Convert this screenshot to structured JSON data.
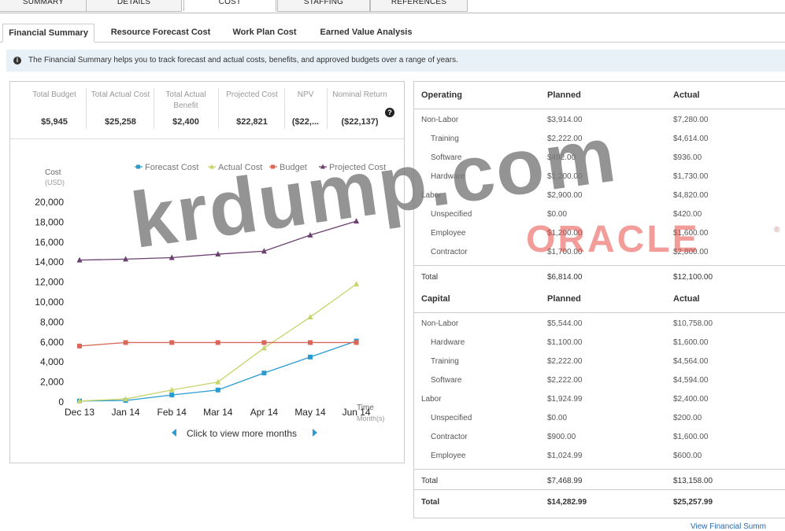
{
  "top_tabs": [
    "SUMMARY",
    "DETAILS",
    "COST",
    "STAFFING",
    "REFERENCES"
  ],
  "sub_tabs": [
    "Financial Summary",
    "Resource Forecast Cost",
    "Work Plan Cost",
    "Earned Value Analysis"
  ],
  "info": {
    "text": "The Financial Summary helps you to track forecast and actual costs, benefits, and approved budgets over a range of years.",
    "icon": "info-icon"
  },
  "kpis": [
    {
      "label": "Total Budget",
      "value": "$5,945"
    },
    {
      "label": "Total Actual Cost",
      "value": "$25,258"
    },
    {
      "label": "Total Actual Benefit",
      "value": "$2,400"
    },
    {
      "label": "Projected Cost",
      "value": "$22,821"
    },
    {
      "label": "NPV",
      "value": "($22,..."
    },
    {
      "label": "Nominal Return",
      "value": "($22,137)"
    }
  ],
  "help_icon": "help-icon",
  "chart_data": {
    "type": "line",
    "ylabel": "Cost",
    "ylabel_unit": "(USD)",
    "xlabel": "Time",
    "xlabel_unit": "Month(s)",
    "categories": [
      "Dec 13",
      "Jan 14",
      "Feb 14",
      "Mar 14",
      "Apr 14",
      "May 14",
      "Jun 14"
    ],
    "y_ticks": [
      "0",
      "2,000",
      "4,000",
      "6,000",
      "8,000",
      "10,000",
      "12,000",
      "14,000",
      "16,000",
      "18,000",
      "20,000"
    ],
    "ylim": [
      0,
      20000
    ],
    "legend_position": "top",
    "series": [
      {
        "name": "Forecast Cost",
        "color": "#2a9ad3",
        "marker": "square",
        "values": [
          100,
          150,
          700,
          1200,
          2900,
          4500,
          6100
        ]
      },
      {
        "name": "Actual Cost",
        "color": "#c8d46a",
        "marker": "triangle",
        "values": [
          100,
          300,
          1200,
          2000,
          5400,
          8500,
          11800
        ]
      },
      {
        "name": "Budget",
        "color": "#d9685a",
        "marker": "square",
        "values": [
          5600,
          5950,
          5950,
          5950,
          5950,
          5950,
          5950
        ]
      },
      {
        "name": "Projected Cost",
        "color": "#6b3f6e",
        "marker": "triangle",
        "values": [
          14200,
          14300,
          14450,
          14800,
          15100,
          16700,
          18100
        ]
      }
    ]
  },
  "nav": {
    "label": "Click to view more months",
    "prev_icon": "chevron-left-icon",
    "next_icon": "chevron-right-icon"
  },
  "operating": {
    "header": "Operating",
    "planned_header": "Planned",
    "actual_header": "Actual",
    "rows": [
      {
        "label": "Non-Labor",
        "planned": "$3,914.00",
        "actual": "$7,280.00",
        "indent": false
      },
      {
        "label": "Training",
        "planned": "$2,222.00",
        "actual": "$4,614.00",
        "indent": true
      },
      {
        "label": "Software",
        "planned": "$492.00",
        "actual": "$936.00",
        "indent": true
      },
      {
        "label": "Hardware",
        "planned": "$1,200.00",
        "actual": "$1,730.00",
        "indent": true
      },
      {
        "label": "Labor",
        "planned": "$2,900.00",
        "actual": "$4,820.00",
        "indent": false
      },
      {
        "label": "Unspecified",
        "planned": "$0.00",
        "actual": "$420.00",
        "indent": true
      },
      {
        "label": "Employee",
        "planned": "$1,200.00",
        "actual": "$1,600.00",
        "indent": true
      },
      {
        "label": "Contractor",
        "planned": "$1,700.00",
        "actual": "$2,800.00",
        "indent": true
      }
    ],
    "total": {
      "label": "Total",
      "planned": "$6,814.00",
      "actual": "$12,100.00"
    }
  },
  "capital": {
    "header": "Capital",
    "planned_header": "Planned",
    "actual_header": "Actual",
    "rows": [
      {
        "label": "Non-Labor",
        "planned": "$5,544.00",
        "actual": "$10,758.00",
        "indent": false
      },
      {
        "label": "Hardware",
        "planned": "$1,100.00",
        "actual": "$1,600.00",
        "indent": true
      },
      {
        "label": "Training",
        "planned": "$2,222.00",
        "actual": "$4,564.00",
        "indent": true
      },
      {
        "label": "Software",
        "planned": "$2,222.00",
        "actual": "$4,594.00",
        "indent": true
      },
      {
        "label": "Labor",
        "planned": "$1,924.99",
        "actual": "$2,400.00",
        "indent": false
      },
      {
        "label": "Unspecified",
        "planned": "$0.00",
        "actual": "$200.00",
        "indent": true
      },
      {
        "label": "Contractor",
        "planned": "$900.00",
        "actual": "$1,600.00",
        "indent": true
      },
      {
        "label": "Employee",
        "planned": "$1,024.99",
        "actual": "$600.00",
        "indent": true
      }
    ],
    "total": {
      "label": "Total",
      "planned": "$7,468.99",
      "actual": "$13,158.00"
    }
  },
  "grand_total": {
    "label": "Total",
    "planned": "$14,282.99",
    "actual": "$25,257.99"
  },
  "bottom_link": "View Financial Summ",
  "watermark": {
    "krdump": "krdump.com",
    "oracle": "ORACLE",
    "reg": "®"
  }
}
